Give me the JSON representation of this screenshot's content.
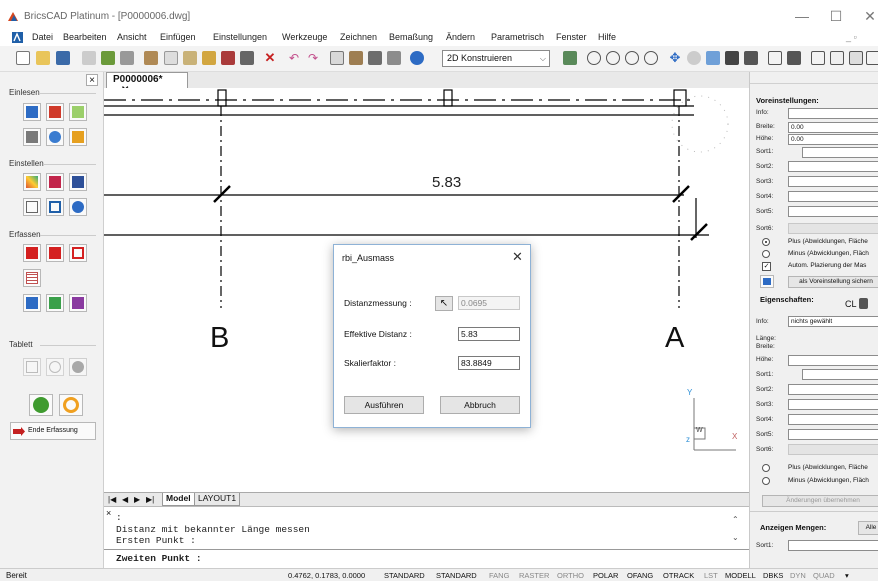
{
  "window": {
    "title": "BricsCAD Platinum - [P0000006.dwg]",
    "minimize": "—",
    "maximize": "☐",
    "close": "✕"
  },
  "menu": [
    "Datei",
    "Bearbeiten",
    "Ansicht",
    "Einfügen",
    "Einstellungen",
    "Werkzeuge",
    "Zeichnen",
    "Bemaßung",
    "Ändern",
    "Parametrisch",
    "Fenster",
    "Hilfe"
  ],
  "toolbar": {
    "view_select": "2D Konstruieren"
  },
  "left_panel": {
    "close_label": "×",
    "sections": {
      "einlesen": "Einlesen",
      "einstellen": "Einstellen",
      "erfassen": "Erfassen",
      "tablett": "Tablett"
    },
    "end_button": "Ende Erfassung"
  },
  "document": {
    "tab": "P0000006*",
    "tab_close": "✕"
  },
  "drawing": {
    "dimension": "5.83",
    "label_b": "B",
    "label_a": "A",
    "ucs_y": "Y",
    "ucs_x": "X",
    "ucs_w": "W"
  },
  "dialog": {
    "title": "rbi_Ausmass",
    "close": "✕",
    "distance_measure_label": "Distanzmessung :",
    "distance_measure_value": "0.0695",
    "effective_distance_label": "Effektive Distanz :",
    "effective_distance_value": "5.83",
    "scale_label": "Skalierfaktor :",
    "scale_value": "83.8849",
    "run_button": "Ausführen",
    "cancel_button": "Abbruch"
  },
  "layout_tabs": {
    "model": "Model",
    "layout": "LAYOUT1"
  },
  "command": {
    "lines": [
      ":",
      "Distanz mit bekannter Länge messen",
      "Ersten Punkt :"
    ],
    "prompt": "Zweiten Punkt :",
    "close": "×"
  },
  "right_panel": {
    "presets_title": "Voreinstellungen:",
    "info": "Info:",
    "width": "Breite:",
    "width_value": "0.00",
    "height": "Höhe:",
    "height_value": "0.00",
    "sorts": [
      "Sort1:",
      "Sort2:",
      "Sort3:",
      "Sort4:",
      "Sort5:",
      "Sort6:"
    ],
    "opt_plus": "Plus (Abwicklungen, Fläche",
    "opt_minus": "Minus (Abwicklungen, Fläch",
    "opt_auto": "Autom. Plazierung der Mas",
    "save_preset": "als Voreinstellung sichern",
    "properties_title": "Eigenschaften:",
    "props_info": "Info:",
    "props_info_value": "nichts gewählt",
    "length_width": "Länge:\nBreite:",
    "props_height": "Höhe:",
    "props_sorts": [
      "Sort1:",
      "Sort2:",
      "Sort3:",
      "Sort4:",
      "Sort5:",
      "Sort6:"
    ],
    "opt2_plus": "Plus (Abwicklungen, Fläche",
    "opt2_minus": "Minus (Abwicklungen, Fläch",
    "apply_changes": "Änderungen übernehmen",
    "show_quantities": "Anzeigen Mengen:",
    "all_button": "Alle",
    "qty_sort1": "Sort1:"
  },
  "status": {
    "ready": "Bereit",
    "coords": "0.4762, 0.1783, 0.0000",
    "buttons": [
      "STANDARD",
      "STANDARD",
      "FANG",
      "RASTER",
      "ORTHO",
      "POLAR",
      "OFANG",
      "OTRACK",
      "LST",
      "MODELL",
      "DBKS",
      "DYN",
      "QUAD"
    ],
    "active": [
      "STANDARD",
      "STANDARD",
      "POLAR",
      "OFANG",
      "OTRACK",
      "MODELL",
      "DBKS"
    ]
  },
  "colors": {
    "accent": "#1f5fa8",
    "canvas_bg": "#ffffff",
    "dialog_border": "#8eb2d6"
  }
}
